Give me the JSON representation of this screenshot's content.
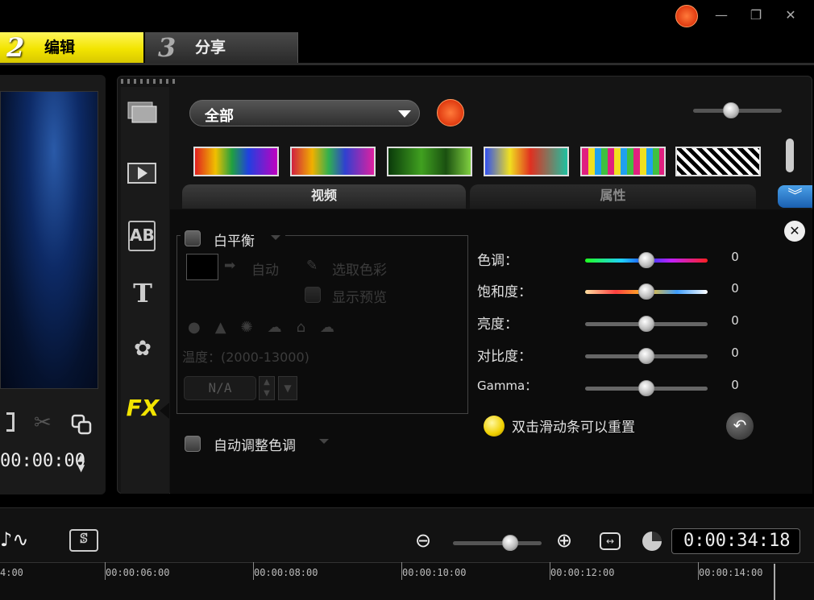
{
  "steps": {
    "edit": {
      "number": "2",
      "label": "编辑"
    },
    "share": {
      "number": "3",
      "label": "分享"
    }
  },
  "window_controls": {
    "minimize": "—",
    "restore": "❐",
    "close": "✕"
  },
  "library": {
    "filter": "全部",
    "sidebar": [
      "media-icon",
      "transition-icon",
      "title-ab-icon",
      "text-t-icon",
      "graphic-flower-icon",
      "fx-icon"
    ],
    "fx_label": "FX",
    "tabs": [
      "视频",
      "属性"
    ]
  },
  "white_balance": {
    "title": "白平衡",
    "auto": "自动",
    "pick_color": "选取色彩",
    "show_preview": "显示预览",
    "temperature": "温度：(2000-13000)",
    "value": "N/A"
  },
  "auto_tone": "自动调整色调",
  "adjustments": [
    {
      "label": "色调：",
      "value": "0"
    },
    {
      "label": "饱和度：",
      "value": "0"
    },
    {
      "label": "亮度：",
      "value": "0"
    },
    {
      "label": "对比度：",
      "value": "0"
    },
    {
      "label": "Gamma：",
      "value": "0"
    }
  ],
  "hint": "双击滑动条可以重置",
  "preview": {
    "timecode": "00:00:00"
  },
  "timeline": {
    "timecode": "0:00:34:18",
    "ruler": [
      "4:00",
      "00:00:06:00",
      "00:00:08:00",
      "00:00:10:00",
      "00:00:12:00",
      "00:00:14:00"
    ]
  },
  "colors": {
    "accent_yellow": "#f2e400",
    "brand_orange": "#e03a10"
  }
}
